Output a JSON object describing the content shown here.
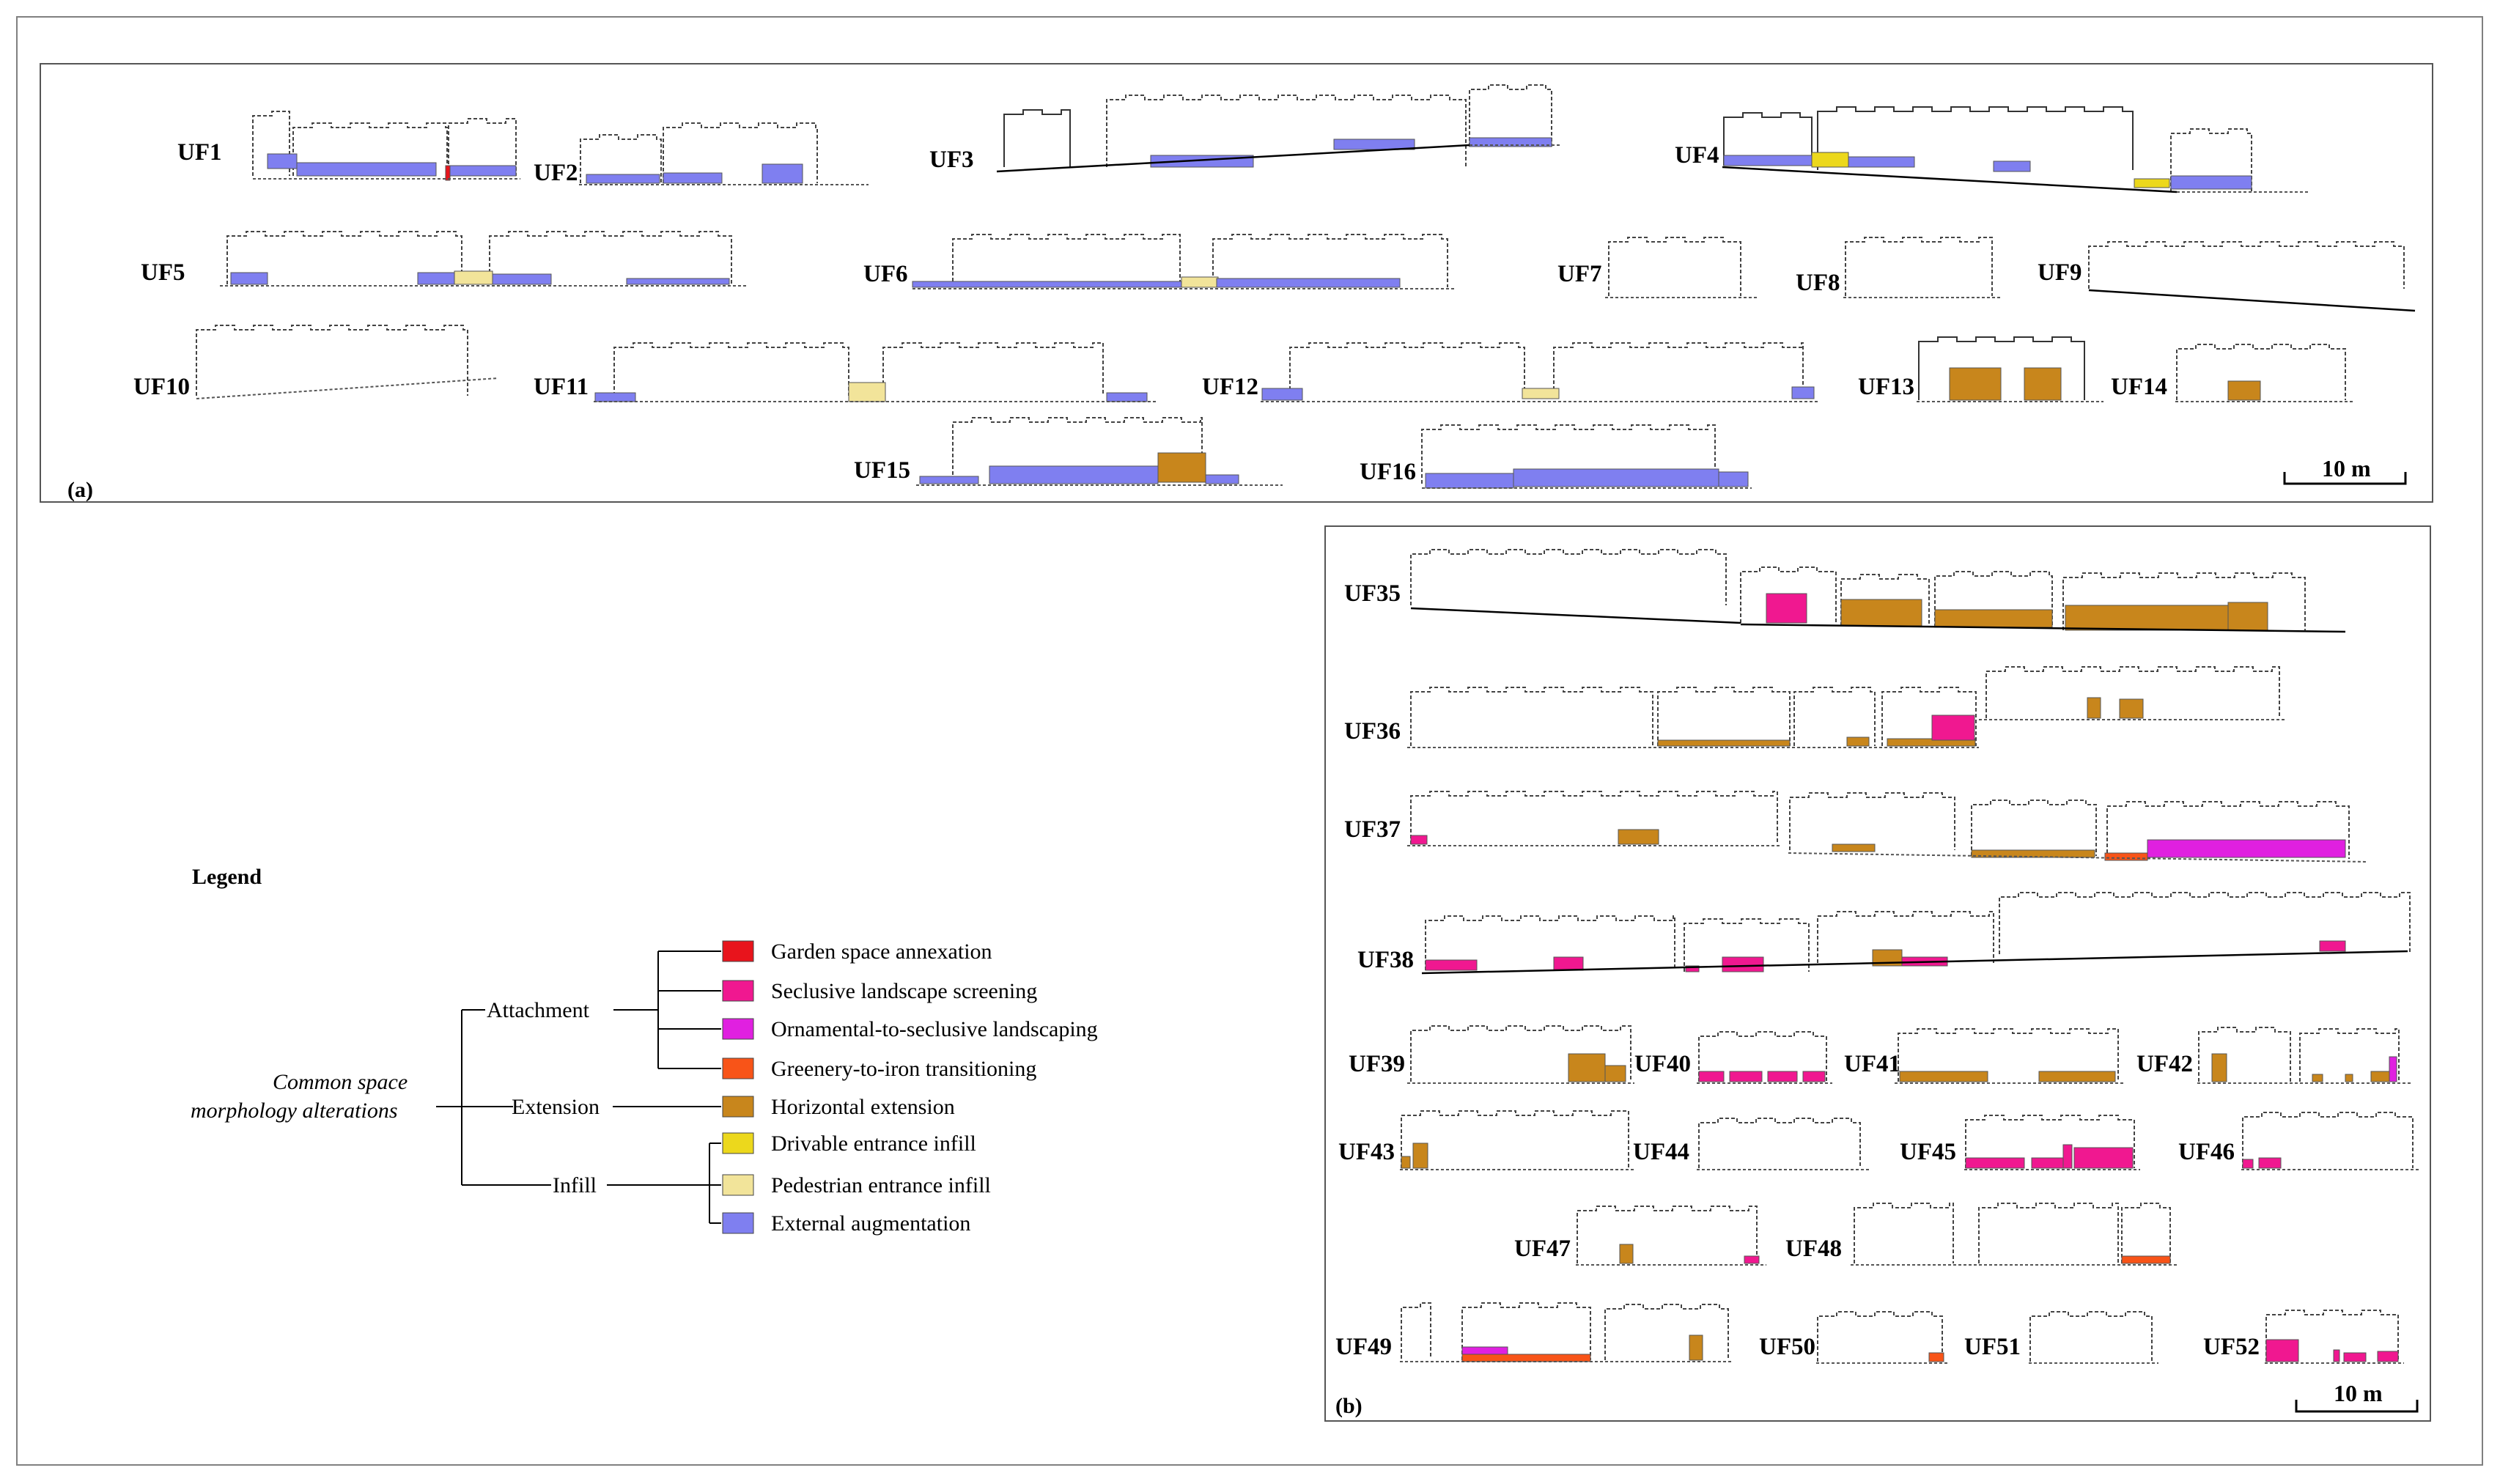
{
  "panel_a": {
    "label": "(a)",
    "scale": "10 m",
    "units": [
      "UF1",
      "UF2",
      "UF3",
      "UF4",
      "UF5",
      "UF6",
      "UF7",
      "UF8",
      "UF9",
      "UF10",
      "UF11",
      "UF12",
      "UF13",
      "UF14",
      "UF15",
      "UF16"
    ]
  },
  "panel_b": {
    "label": "(b)",
    "scale": "10 m",
    "units": [
      "UF35",
      "UF36",
      "UF37",
      "UF38",
      "UF39",
      "UF40",
      "UF41",
      "UF42",
      "UF43",
      "UF44",
      "UF45",
      "UF46",
      "UF47",
      "UF48",
      "UF49",
      "UF50",
      "UF51",
      "UF52"
    ]
  },
  "legend": {
    "title": "Legend",
    "root": "Common space morphology alterations",
    "root_lines": [
      "Common space",
      "morphology alterations"
    ],
    "groups": [
      "Attachment",
      "Extension",
      "Infill"
    ],
    "items": [
      {
        "label": "Garden space annexation",
        "color": "#e8141c",
        "group": "Attachment"
      },
      {
        "label": "Seclusive landscape screening",
        "color": "#f01890",
        "group": "Attachment"
      },
      {
        "label": "Ornamental-to-seclusive landscaping",
        "color": "#e020e0",
        "group": "Attachment"
      },
      {
        "label": "Greenery-to-iron transitioning",
        "color": "#f85418",
        "group": "Attachment"
      },
      {
        "label": "Horizontal extension",
        "color": "#c8861c",
        "group": "Extension"
      },
      {
        "label": "Drivable entrance infill",
        "color": "#ecd81c",
        "group": "Infill"
      },
      {
        "label": "Pedestrian entrance infill",
        "color": "#f2e49a",
        "group": "Infill"
      },
      {
        "label": "External augmentation",
        "color": "#7f7ff0",
        "group": "Infill"
      }
    ]
  }
}
